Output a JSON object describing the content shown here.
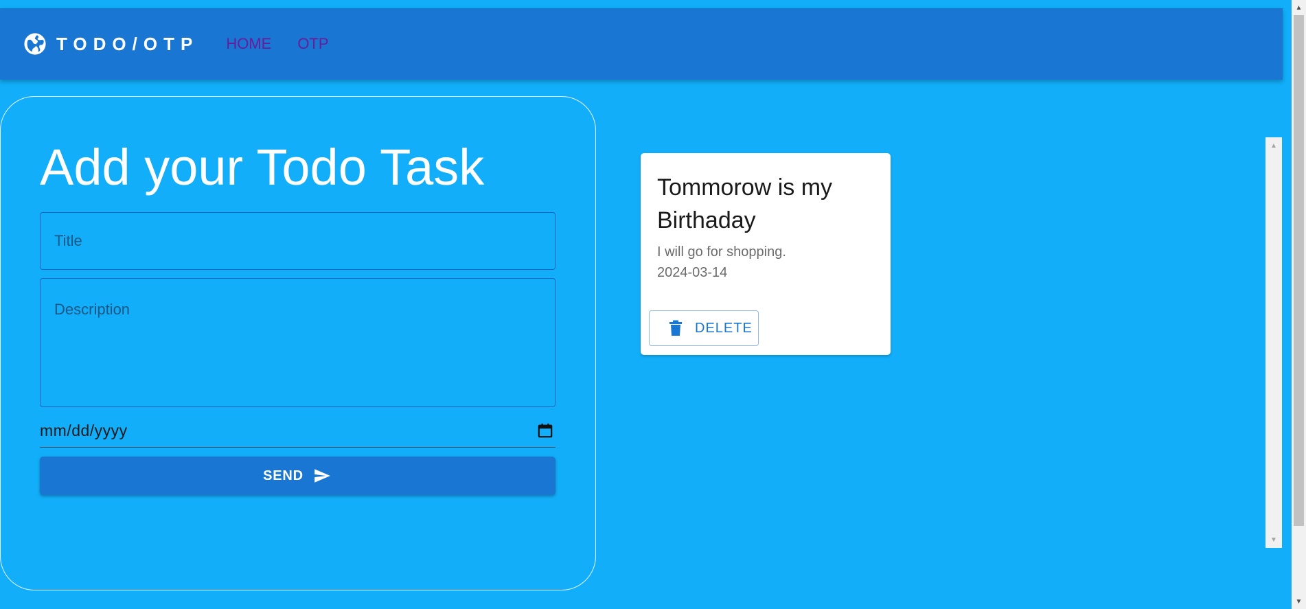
{
  "header": {
    "brand_icon": "globe-icon",
    "brand": "TODO/OTP",
    "nav": [
      {
        "label": "HOME"
      },
      {
        "label": "OTP"
      }
    ]
  },
  "form": {
    "title": "Add your Todo Task",
    "title_placeholder": "Title",
    "description_placeholder": "Description",
    "date_value": "mm/dd/yyyy",
    "date_icon": "calendar-icon",
    "send_label": "SEND",
    "send_icon": "send-icon"
  },
  "todos": [
    {
      "title": "Tommorow is my Birthaday",
      "description": "I will go for shopping.",
      "date": "2024-03-14",
      "delete_label": "DELETE",
      "delete_icon": "trash-icon"
    }
  ],
  "colors": {
    "page_background": "#12aef9",
    "appbar": "#1976d2",
    "nav_link": "#6a1b9a",
    "button": "#1976d2",
    "card": "#ffffff"
  }
}
